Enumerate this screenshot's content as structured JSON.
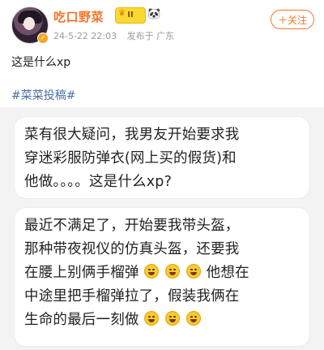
{
  "author": {
    "name": "吃口野菜",
    "level_badge": "II",
    "timestamp": "24-5-22 22:03",
    "source": "发布于 广东"
  },
  "follow_label": "＋关注",
  "post": {
    "text": "这是什么xp",
    "hashtag": "#菜菜投稿#"
  },
  "image": {
    "bubble1": [
      "菜有很大疑问，我男友开始要求我",
      "穿迷彩服防弹衣(网上买的假货)和",
      "他做。。。。这是什么xp?"
    ],
    "bubble2": {
      "line1": "最近不满足了，开始要我带头盔，",
      "line2": "那种带夜视仪的仿真头盔，还要我",
      "line3": "在腰上别俩手榴弹",
      "line4": "他想在",
      "line5": "中途里把手榴弹拉了，假装我俩在",
      "line6": "生命的最后一刻做"
    }
  },
  "colors": {
    "accent": "#f7752a",
    "hashtag": "#4a6fa5",
    "meta": "#9a9a9a",
    "image_bg": "#f3f3f3"
  },
  "icons": [
    "crown-icon",
    "panda-icon",
    "laughing-emoji-icon"
  ]
}
